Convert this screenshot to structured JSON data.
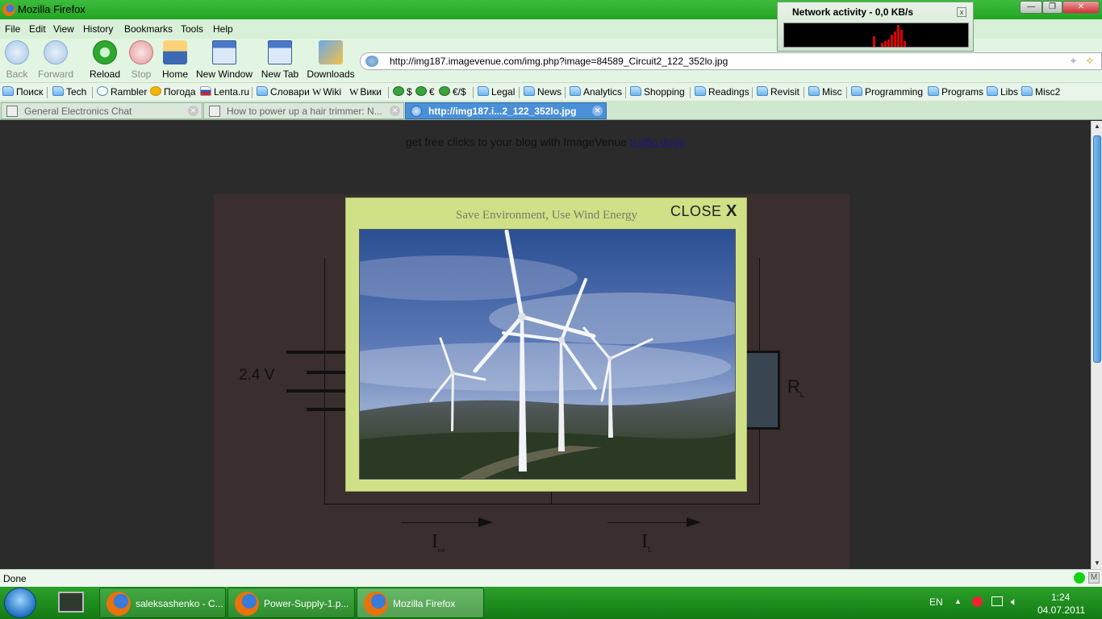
{
  "window": {
    "title": "Mozilla Firefox"
  },
  "menu": [
    "File",
    "Edit",
    "View",
    "History",
    "Bookmarks",
    "Tools",
    "Help"
  ],
  "nav": {
    "back": "Back",
    "forward": "Forward",
    "reload": "Reload",
    "stop": "Stop",
    "home": "Home",
    "new_window": "New Window",
    "new_tab": "New Tab",
    "downloads": "Downloads"
  },
  "url": "http://img187.imagevenue.com/img.php?image=84589_Circuit2_122_352lo.jpg",
  "bookmarks": [
    "Поиск",
    "Tech",
    "Rambler",
    "Погода",
    "Lenta.ru",
    "Словари",
    "Wiki",
    "Вики",
    "$",
    "€",
    "€/$",
    "Legal",
    "News",
    "Analytics",
    "Shopping",
    "Readings",
    "Revisit",
    "Misc",
    "Programming",
    "Programs",
    "Libs",
    "Misc2"
  ],
  "tabs": [
    {
      "label": "General Electronics Chat",
      "active": false
    },
    {
      "label": "How to power up a hair trimmer: N...",
      "active": false
    },
    {
      "label": "http://img187.i...2_122_352lo.jpg",
      "active": true
    }
  ],
  "page": {
    "promo_text": "get free clicks to your blog with ImageVenue",
    "promo_link": "traffic drive",
    "circuit": {
      "voltage": "2.4 V",
      "load": "R",
      "load_sub": "L",
      "i_tot": "I",
      "i_tot_sub": "tot",
      "i_l": "I",
      "i_l_sub": "L"
    },
    "modal": {
      "caption": "Save Environment, Use Wind Energy",
      "close": "CLOSE",
      "close_x": "X"
    }
  },
  "status": {
    "text": "Done"
  },
  "network": {
    "title": "Network activity - 0,0 KB/s",
    "close": "x"
  },
  "taskbar": {
    "items": [
      "saleksashenko - C...",
      "Power-Supply-1.p...",
      "Mozilla Firefox"
    ],
    "lang": "EN",
    "time": "1:24",
    "date": "04.07.2011"
  }
}
